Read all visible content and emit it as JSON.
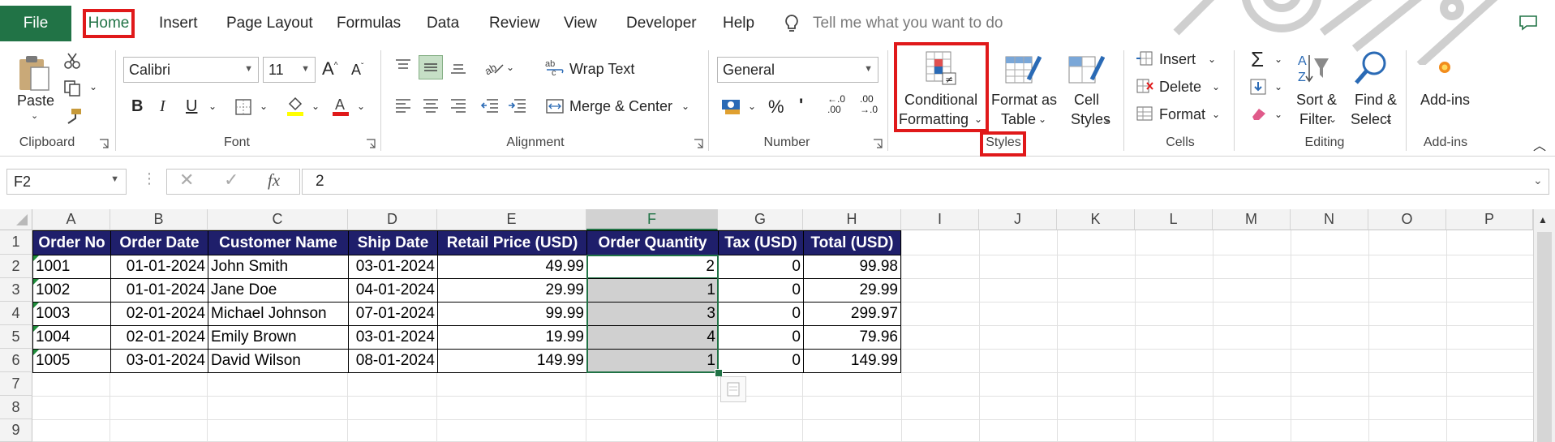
{
  "tabs": {
    "file": "File",
    "home": "Home",
    "insert": "Insert",
    "page_layout": "Page Layout",
    "formulas": "Formulas",
    "data": "Data",
    "review": "Review",
    "view": "View",
    "developer": "Developer",
    "help": "Help"
  },
  "tell_me": {
    "placeholder": "Tell me what you want to do"
  },
  "ribbon": {
    "clipboard": {
      "label": "Clipboard",
      "paste": "Paste"
    },
    "font": {
      "label": "Font",
      "name": "Calibri",
      "size": "11",
      "bold": "B",
      "italic": "I",
      "underline": "U"
    },
    "alignment": {
      "label": "Alignment",
      "wrap_text": "Wrap Text",
      "merge_center": "Merge & Center"
    },
    "number": {
      "label": "Number",
      "format": "General",
      "percent": "%",
      "comma": "'",
      "inc_decimal_a": "←.0",
      "inc_decimal_b": ".00",
      "dec_decimal_a": ".00",
      "dec_decimal_b": "→.0"
    },
    "styles": {
      "label": "Styles",
      "conditional_formatting_1": "Conditional",
      "conditional_formatting_2": "Formatting",
      "format_table_1": "Format as",
      "format_table_2": "Table",
      "cell_styles_1": "Cell",
      "cell_styles_2": "Styles"
    },
    "cells": {
      "label": "Cells",
      "insert": "Insert",
      "delete": "Delete",
      "format": "Format"
    },
    "editing": {
      "label": "Editing",
      "sort_filter_1": "Sort &",
      "sort_filter_2": "Filter",
      "find_select_1": "Find &",
      "find_select_2": "Select"
    },
    "addins": {
      "label": "Add-ins",
      "button": "Add-ins"
    }
  },
  "formula_bar": {
    "name_box": "F2",
    "fx": "fx",
    "value": "2"
  },
  "columns": [
    "A",
    "B",
    "C",
    "D",
    "E",
    "F",
    "G",
    "H",
    "I",
    "J",
    "K",
    "L",
    "M",
    "N",
    "O",
    "P"
  ],
  "rows": [
    "1",
    "2",
    "3",
    "4",
    "5",
    "6",
    "7",
    "8",
    "9"
  ],
  "table": {
    "headers": [
      "Order No",
      "Order Date",
      "Customer Name",
      "Ship Date",
      "Retail Price (USD)",
      "Order Quantity",
      "Tax (USD)",
      "Total (USD)"
    ],
    "rows": [
      [
        "1001",
        "01-01-2024",
        "John Smith",
        "03-01-2024",
        "49.99",
        "2",
        "0",
        "99.98"
      ],
      [
        "1002",
        "01-01-2024",
        "Jane Doe",
        "04-01-2024",
        "29.99",
        "1",
        "0",
        "29.99"
      ],
      [
        "1003",
        "02-01-2024",
        "Michael Johnson",
        "07-01-2024",
        "99.99",
        "3",
        "0",
        "299.97"
      ],
      [
        "1004",
        "02-01-2024",
        "Emily Brown",
        "03-01-2024",
        "19.99",
        "4",
        "0",
        "79.96"
      ],
      [
        "1005",
        "03-01-2024",
        "David Wilson",
        "08-01-2024",
        "149.99",
        "1",
        "0",
        "149.99"
      ]
    ]
  },
  "colors": {
    "excel_green": "#217346",
    "header_fill": "#1f1f6b",
    "highlight_red": "#e0191a",
    "selected_fill": "#d0d0d0"
  }
}
